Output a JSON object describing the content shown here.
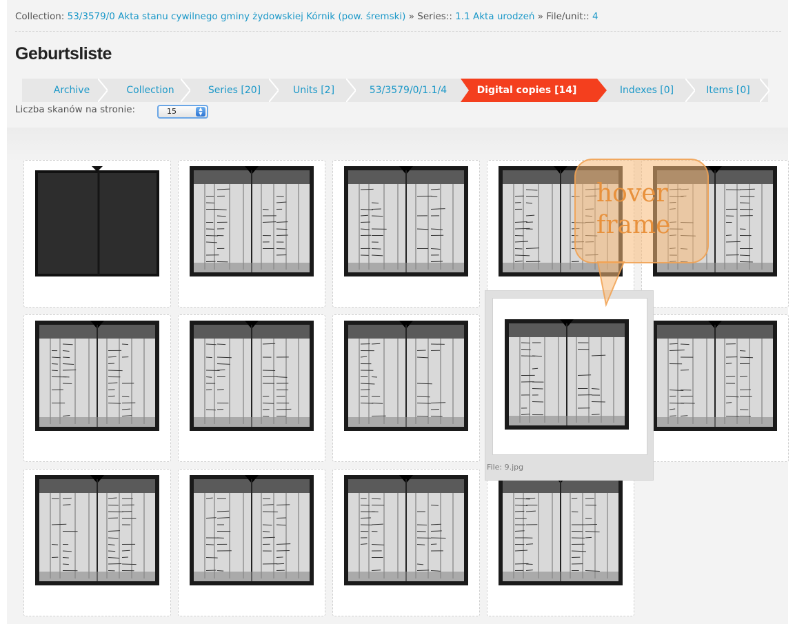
{
  "breadcrumb": {
    "prefix": "Collection: ",
    "collection_link": "53/3579/0 Akta stanu cywilnego gminy żydowskiej Kórnik (pow. śremski)",
    "sep1": " » Series:: ",
    "series_link": "1.1 Akta urodzeń",
    "sep2": " » File/unit:: ",
    "unit_link": "4"
  },
  "page_title": "Geburtsliste",
  "tabs": [
    {
      "label": "Archive"
    },
    {
      "label": "Collection"
    },
    {
      "label": "Series [20]"
    },
    {
      "label": "Units [2]"
    },
    {
      "label": "53/3579/0/1.1/4"
    },
    {
      "label": "Digital copies [14]",
      "active": true
    },
    {
      "label": "Indexes [0]"
    },
    {
      "label": "Items [0]"
    }
  ],
  "per_page": {
    "label": "Liczba skanów na stronie:",
    "value": "15"
  },
  "thumbnails": [
    {
      "name": "scan-1"
    },
    {
      "name": "scan-2"
    },
    {
      "name": "scan-3"
    },
    {
      "name": "scan-4"
    },
    {
      "name": "scan-5"
    },
    {
      "name": "scan-6"
    },
    {
      "name": "scan-7"
    },
    {
      "name": "scan-8"
    },
    {
      "name": "scan-9"
    },
    {
      "name": "scan-10"
    },
    {
      "name": "scan-11"
    },
    {
      "name": "scan-12"
    },
    {
      "name": "scan-13"
    },
    {
      "name": "scan-14"
    }
  ],
  "hover": {
    "file_label": "File: 9.jpg",
    "callout_text": "hover frame"
  },
  "colors": {
    "link": "#1b98c8",
    "active_tab": "#f43f1e",
    "callout": "#f7ba78"
  }
}
